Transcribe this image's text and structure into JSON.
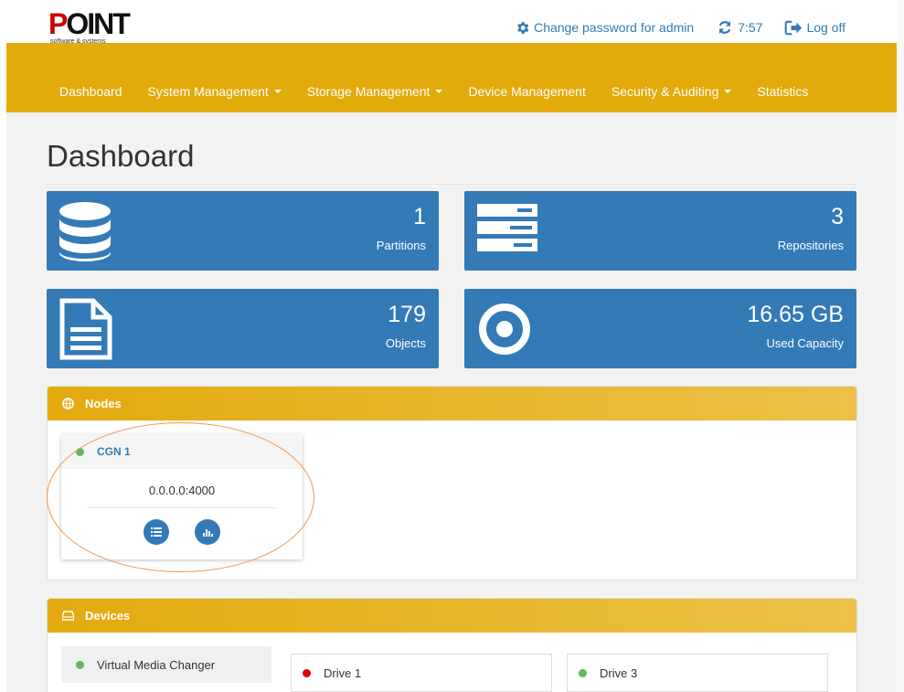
{
  "header": {
    "logo_text_red": "P",
    "logo_text": "OINT",
    "logo_sub": "software & systems",
    "change_password": "Change password for admin",
    "session_time": "7:57",
    "logoff": "Log off"
  },
  "nav": {
    "items": [
      {
        "label": "Dashboard",
        "dropdown": false
      },
      {
        "label": "System Management",
        "dropdown": true
      },
      {
        "label": "Storage Management",
        "dropdown": true
      },
      {
        "label": "Device Management",
        "dropdown": false
      },
      {
        "label": "Security & Auditing",
        "dropdown": true
      },
      {
        "label": "Statistics",
        "dropdown": false
      }
    ]
  },
  "page_title": "Dashboard",
  "tiles": [
    {
      "value": "1",
      "label": "Partitions",
      "icon": "database-icon"
    },
    {
      "value": "3",
      "label": "Repositories",
      "icon": "server-icon"
    },
    {
      "value": "179",
      "label": "Objects",
      "icon": "document-icon"
    },
    {
      "value": "16.65 GB",
      "label": "Used Capacity",
      "icon": "disc-icon"
    }
  ],
  "nodes_panel": {
    "title": "Nodes",
    "node": {
      "name": "CGN 1",
      "address": "0.0.0.0:4000",
      "status_color": "#5cb85c"
    }
  },
  "devices_panel": {
    "title": "Devices",
    "changer": {
      "name": "Virtual Media Changer",
      "status_color": "#5cb85c"
    },
    "drives": [
      {
        "name": "Drive 1",
        "status_color": "#e00000"
      },
      {
        "name": "Drive 3",
        "status_color": "#5cb85c"
      }
    ]
  },
  "colors": {
    "accent": "#e2aa0b",
    "primary": "#337ab7"
  }
}
